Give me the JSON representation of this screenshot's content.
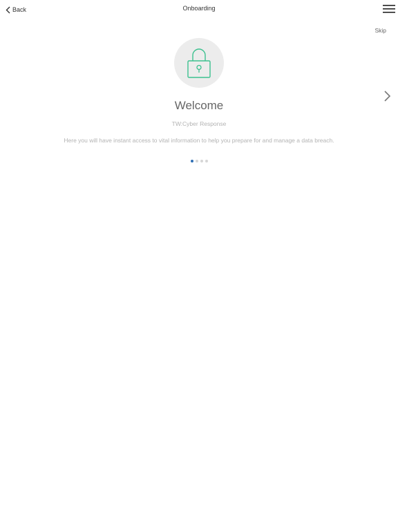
{
  "nav": {
    "back_label": "Back",
    "title": "Onboarding"
  },
  "skip_label": "Skip",
  "slide": {
    "icon": "lock-icon",
    "title": "Welcome",
    "subtitle": "TW:Cyber Response",
    "description": "Here you will have instant access to vital information to help you prepare for and manage a data breach."
  },
  "pagination": {
    "total": 4,
    "current": 1
  },
  "colors": {
    "icon_green": "#3cc18f",
    "active_dot": "#2f6fb5",
    "inactive_dot": "#d6d6d6",
    "circle_bg": "#ececec"
  }
}
